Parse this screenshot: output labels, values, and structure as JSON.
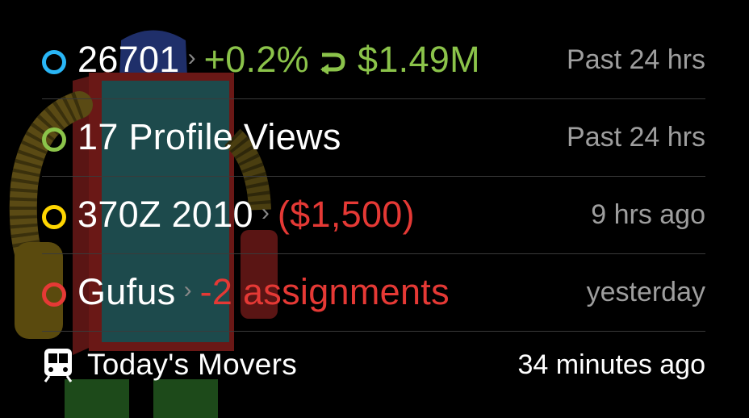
{
  "rows": [
    {
      "main": "26701",
      "change": "+0.2%",
      "value": "$1.49M",
      "time": "Past 24 hrs",
      "dot_color": "#29b6f6",
      "accent_color": "#8bc34a",
      "dot_icon": "circle-outline-icon",
      "trend_icon": "redo-arrow-icon"
    },
    {
      "main": "17 Profile Views",
      "time": "Past 24 hrs",
      "dot_color": "#8bc34a",
      "dot_icon": "circle-outline-icon"
    },
    {
      "main": "370Z 2010",
      "change": "($1,500)",
      "time": "9 hrs ago",
      "dot_color": "#ffd600",
      "accent_color": "#e53935",
      "dot_icon": "circle-outline-icon"
    },
    {
      "main": "Gufus",
      "change": "-2 assignments",
      "time": "yesterday",
      "dot_color": "#e53935",
      "accent_color": "#e53935",
      "dot_icon": "circle-outline-icon"
    }
  ],
  "footer": {
    "label": "Today's Movers",
    "time": "34 minutes ago",
    "icon": "train-icon"
  },
  "chevron": "›"
}
